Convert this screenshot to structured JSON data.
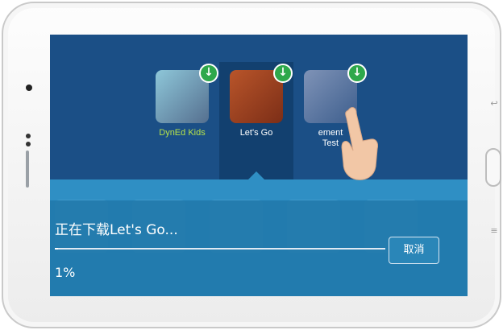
{
  "apps": [
    {
      "label": "DynEd Kids",
      "label_color": "#b7e34a",
      "icon": "download-icon"
    },
    {
      "label": "Let's Go",
      "label_color": "#ffffff",
      "icon": "download-icon"
    },
    {
      "label": "ement\nTest",
      "label_color": "#ffffff",
      "icon": "download-icon"
    }
  ],
  "dialog": {
    "title": "正在下载Let's Go...",
    "progress_percent_text": "1%",
    "progress_value": 0.01,
    "cancel_label": "取消"
  },
  "colors": {
    "screen_bg": "#1b4f86",
    "selection_bg": "#12406f",
    "dialog_bg": "#227aab",
    "download_badge": "#2ea84b"
  }
}
